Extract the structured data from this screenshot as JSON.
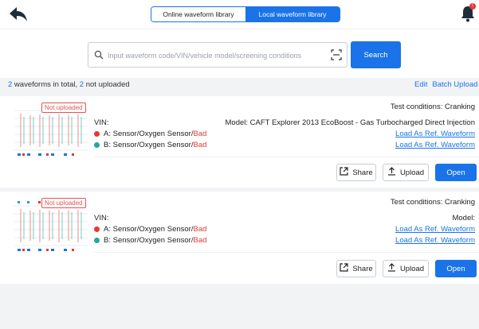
{
  "header": {
    "tabs": [
      "Online waveform library",
      "Local waveform library"
    ],
    "active_tab": "Local waveform library",
    "notification_badge": "!"
  },
  "search": {
    "placeholder": "Input waveform code/VIN/vehicle model/screening conditions",
    "value": "",
    "button_label": "Search"
  },
  "summary": {
    "total_count": "2",
    "total_suffix": " waveforms in total, ",
    "not_uploaded_count": "2",
    "not_uploaded_suffix": " not uploaded",
    "edit_label": "Edit",
    "batch_upload_label": "Batch Upload"
  },
  "records": [
    {
      "badge": "Not uploaded",
      "test_conditions": "Test conditions: Cranking",
      "vin_label": "VIN:",
      "model": "Model: CAFT Explorer 2013 EcoBoost - Gas Turbocharged Direct Injection",
      "sensor_a": "A: Sensor/Oxygen Sensor/",
      "sensor_a_status": "Bad",
      "sensor_b": "B: Sensor/Oxygen Sensor/",
      "sensor_b_status": "Bad",
      "ref_a": "Load As Ref. Waveform",
      "ref_b": "Load As Ref. Waveform",
      "share_label": "Share",
      "upload_label": "Upload",
      "open_label": "Open"
    },
    {
      "badge": "Not uploaded",
      "test_conditions": "Test conditions: Cranking",
      "vin_label": "VIN:",
      "model": "Model:",
      "sensor_a": "A: Sensor/Oxygen Sensor/",
      "sensor_a_status": "Bad",
      "sensor_b": "B: Sensor/Oxygen Sensor/",
      "sensor_b_status": "Bad",
      "ref_a": "Load As Ref. Waveform",
      "ref_b": "Load As Ref. Waveform",
      "share_label": "Share",
      "upload_label": "Upload",
      "open_label": "Open"
    }
  ],
  "colors": {
    "accent": "#1a73e8",
    "bad": "#e53935",
    "sensor_a_dot": "#e53935",
    "sensor_b_dot": "#26a69a"
  },
  "icons": [
    "back-arrow-icon",
    "bell-icon",
    "search-icon",
    "scan-icon",
    "share-icon",
    "upload-icon"
  ]
}
